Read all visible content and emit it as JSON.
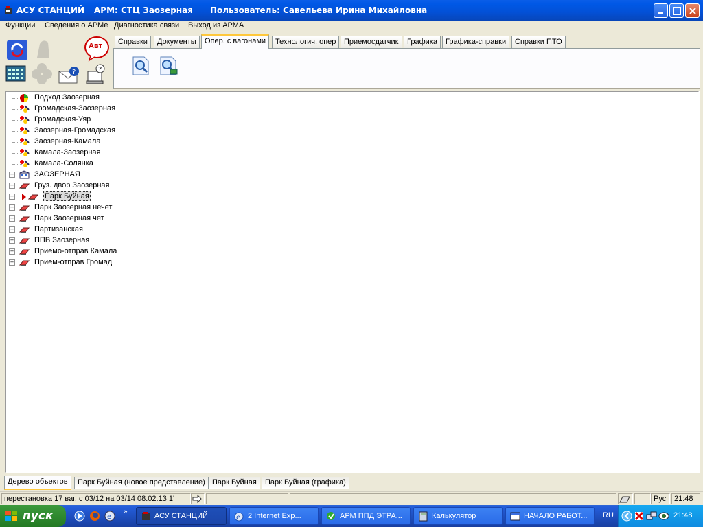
{
  "window": {
    "app_name": "АСУ СТАНЦИЙ",
    "arm": "АРМ: СТЦ Заозерная",
    "user": "Пользователь: Савельева Ирина Михайловна"
  },
  "menu": [
    "Функции",
    "Сведения о АРМе",
    "Диагностика связи",
    "Выход из АРМА"
  ],
  "toolbar_badge": "Авт",
  "tabs": [
    {
      "label": "Справки",
      "active": false
    },
    {
      "label": "Документы",
      "active": false
    },
    {
      "label": "Опер. с вагонами",
      "active": true
    },
    {
      "label": "Технологич. опер",
      "active": false
    },
    {
      "label": "Приемосдатчик",
      "active": false
    },
    {
      "label": "Графика",
      "active": false
    },
    {
      "label": "Графика-справки",
      "active": false
    },
    {
      "label": "Справки ПТО",
      "active": false
    }
  ],
  "tree": [
    {
      "label": "Подход Заозерная",
      "icon": "approach-icon",
      "expandable": false
    },
    {
      "label": "Громадская-Заозерная",
      "icon": "route-icon",
      "expandable": false
    },
    {
      "label": "Громадская-Уяр",
      "icon": "route-icon",
      "expandable": false
    },
    {
      "label": "Заозерная-Громадская",
      "icon": "route-icon",
      "expandable": false
    },
    {
      "label": "Заозерная-Камала",
      "icon": "route-icon",
      "expandable": false
    },
    {
      "label": "Камала-Заозерная",
      "icon": "route-icon",
      "expandable": false
    },
    {
      "label": "Камала-Солянка",
      "icon": "route-icon",
      "expandable": false
    },
    {
      "label": "ЗАОЗЕРНАЯ",
      "icon": "station-icon",
      "expandable": true
    },
    {
      "label": "Груз. двор Заозерная",
      "icon": "park-icon",
      "expandable": true
    },
    {
      "label": "Парк Буйная",
      "icon": "park-icon",
      "expandable": true,
      "selected": true
    },
    {
      "label": "Парк Заозерная нечет",
      "icon": "park-icon",
      "expandable": true
    },
    {
      "label": "Парк Заозерная чет",
      "icon": "park-icon",
      "expandable": true
    },
    {
      "label": "Партизанская",
      "icon": "park-icon",
      "expandable": true
    },
    {
      "label": "ППВ Заозерная",
      "icon": "park-icon",
      "expandable": true
    },
    {
      "label": "Приемо-отправ Камала",
      "icon": "park-icon",
      "expandable": true
    },
    {
      "label": "Прием-отправ Громад",
      "icon": "park-icon",
      "expandable": true
    }
  ],
  "bottom_tabs": [
    {
      "label": "Дерево объектов",
      "active": true
    },
    {
      "label": "Парк Буйная (новое представление)",
      "active": false
    },
    {
      "label": "Парк Буйная",
      "active": false
    },
    {
      "label": "Парк Буйная (графика)",
      "active": false
    }
  ],
  "status": {
    "message": "перестановка  17 ваг. с 03/12   на 03/14    08.02.13 1'",
    "lang": "Рус",
    "time": "21:48"
  },
  "taskbar": {
    "start": "пуск",
    "tasks": [
      {
        "label": "АСУ СТАНЦИЙ",
        "active": true
      },
      {
        "label": "2 Internet Exp...",
        "active": false
      },
      {
        "label": "АРМ ППД ЭТРА...",
        "active": false
      },
      {
        "label": "Калькулятор",
        "active": false
      },
      {
        "label": "НАЧАЛО РАБОТ...",
        "active": false
      }
    ],
    "lang": "RU",
    "clock": "21:48"
  },
  "colors": {
    "titlebar": "#0058e6",
    "window_bg": "#ece9d8",
    "active_tab_accent": "#ffc83c",
    "taskbar": "#245edb",
    "start_button": "#2f8a2f"
  }
}
